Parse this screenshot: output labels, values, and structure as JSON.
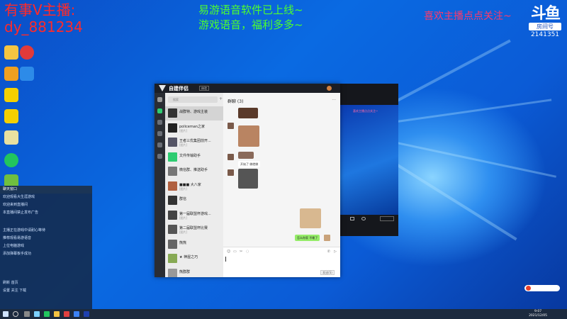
{
  "overlay": {
    "streamer_line1": "有事V主播:",
    "streamer_line2": "dy_881234",
    "ad_line1": "易游语音软件已上线~",
    "ad_line2": "游戏语音，福利多多~",
    "follow_text": "喜欢主播点点关注~",
    "platform_logo": "斗鱼",
    "room_label": "房间号",
    "room_id": "2141351"
  },
  "app": {
    "title": "自建伴侣",
    "version": "体验",
    "search_placeholder": "搜索",
    "contacts": [
      {
        "name": "战群特、游戏主装",
        "preview": ""
      },
      {
        "name": "policeman之家",
        "preview": "[图片]"
      },
      {
        "name": "王者三优集团前开...",
        "preview": "[图片]"
      },
      {
        "name": "文件传输助手",
        "preview": ""
      },
      {
        "name": "微信群、推送助手",
        "preview": ""
      },
      {
        "name": "■■■ 大八家",
        "preview": "[图片]"
      },
      {
        "name": "群信",
        "preview": ""
      },
      {
        "name": "第一届联盟杯游戏...",
        "preview": "[图片]"
      },
      {
        "name": "第二届联盟杯比赛",
        "preview": "[图片]"
      },
      {
        "name": "熊熊",
        "preview": ""
      },
      {
        "name": "★ 神屋之巧",
        "preview": ""
      },
      {
        "name": "熊群群",
        "preview": ""
      }
    ],
    "chat": {
      "title": "群聊 (3)",
      "msg_text_1": "开始了 做就做",
      "msg_self": "怎么你家 不睡了"
    },
    "send_label": "发送(S)"
  },
  "panel": {
    "title": "聊天窗口",
    "rows": [
      "欢迎观看大生涯游戏",
      "欢迎来到直播间",
      "本直播间禁止发布广告",
      "主播正在游戏中请耐心等待",
      "推荐观看易游语音",
      "上位电脑游戏",
      "添加弹幕板手成功",
      "",
      "刷新 首页",
      "设置 关注 下载"
    ]
  },
  "viewer": {
    "banner": "喜欢主播点点关注~"
  },
  "taskbar": {
    "time": "9:07",
    "date": "2021/12/05"
  },
  "colors": {
    "streamer": "#ff2a2a",
    "ad": "#4dff2e",
    "follow": "#ff3a6a",
    "accent_green": "#95ec69"
  }
}
